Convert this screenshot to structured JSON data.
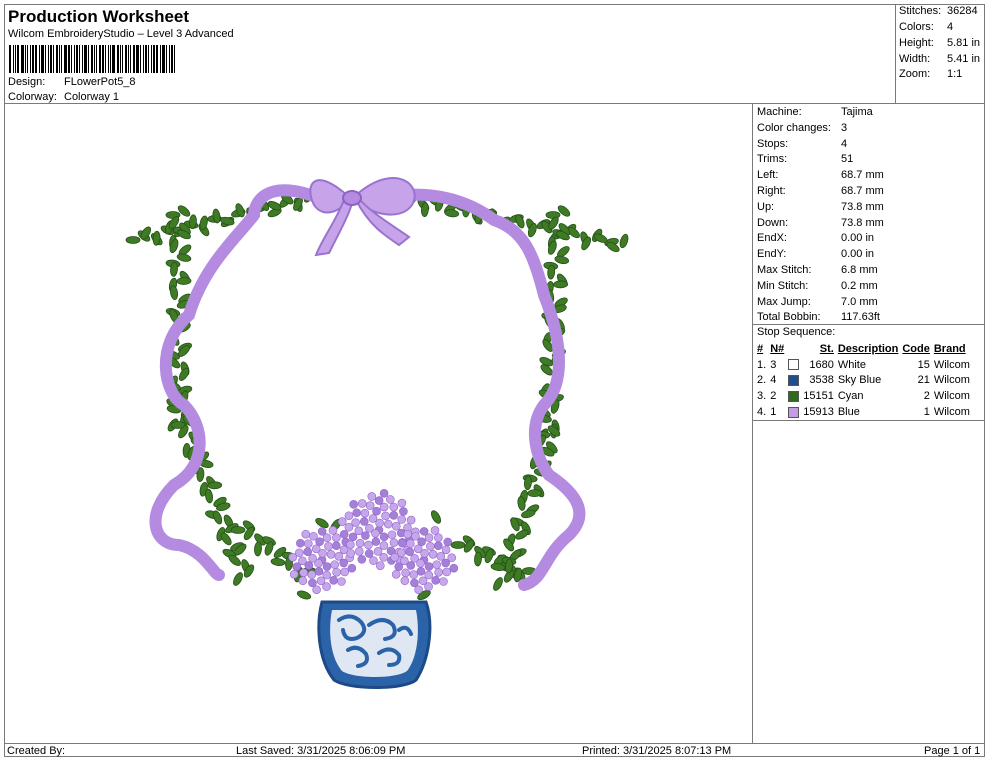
{
  "header": {
    "title": "Production Worksheet",
    "subtitle": "Wilcom EmbroideryStudio – Level 3 Advanced",
    "design_label": "Design:",
    "design_value": "FLowerPot5_8",
    "colorway_label": "Colorway:",
    "colorway_value": "Colorway 1"
  },
  "stats": {
    "stitches_label": "Stitches:",
    "stitches_value": "36284",
    "colors_label": "Colors:",
    "colors_value": "4",
    "height_label": "Height:",
    "height_value": "5.81 in",
    "width_label": "Width:",
    "width_value": "5.41 in",
    "zoom_label": "Zoom:",
    "zoom_value": "1:1"
  },
  "specs": [
    {
      "label": "Machine:",
      "value": "Tajima"
    },
    {
      "label": "Color changes:",
      "value": "3"
    },
    {
      "label": "Stops:",
      "value": "4"
    },
    {
      "label": "Trims:",
      "value": "51"
    },
    {
      "label": "Left:",
      "value": "68.7 mm"
    },
    {
      "label": "Right:",
      "value": "68.7 mm"
    },
    {
      "label": "Up:",
      "value": "73.8 mm"
    },
    {
      "label": "Down:",
      "value": "73.8 mm"
    },
    {
      "label": "EndX:",
      "value": "0.00 in"
    },
    {
      "label": "EndY:",
      "value": "0.00 in"
    },
    {
      "label": "Max Stitch:",
      "value": "6.8 mm"
    },
    {
      "label": "Min Stitch:",
      "value": "0.2 mm"
    },
    {
      "label": "Max Jump:",
      "value": "7.0 mm"
    },
    {
      "label": "Total Bobbin:",
      "value": "117.63ft"
    }
  ],
  "stop_sequence": {
    "title": "Stop Sequence:",
    "headers": [
      "#",
      "N#",
      "St.",
      "Description",
      "Code",
      "Brand"
    ],
    "rows": [
      {
        "idx": "1.",
        "n": "3",
        "color": "#ffffff",
        "st": "1680",
        "desc": "White",
        "code": "15",
        "brand": "Wilcom"
      },
      {
        "idx": "2.",
        "n": "4",
        "color": "#1f4f93",
        "st": "3538",
        "desc": "Sky Blue",
        "code": "21",
        "brand": "Wilcom"
      },
      {
        "idx": "3.",
        "n": "2",
        "color": "#2e6b1f",
        "st": "15151",
        "desc": "Cyan",
        "code": "2",
        "brand": "Wilcom"
      },
      {
        "idx": "4.",
        "n": "1",
        "color": "#c39be6",
        "st": "15913",
        "desc": "Blue",
        "code": "1",
        "brand": "Wilcom"
      }
    ]
  },
  "footer": {
    "created_by": "Created By:",
    "last_saved": "Last Saved: 3/31/2025 8:06:09 PM",
    "printed": "Printed: 3/31/2025 8:07:13 PM",
    "page": "Page 1 of 1"
  },
  "colors": {
    "leaf": "#3f7a24",
    "ribbon": "#b48be0",
    "vase_blue": "#2b63a8",
    "hydrangea": "#c8a6ec"
  }
}
